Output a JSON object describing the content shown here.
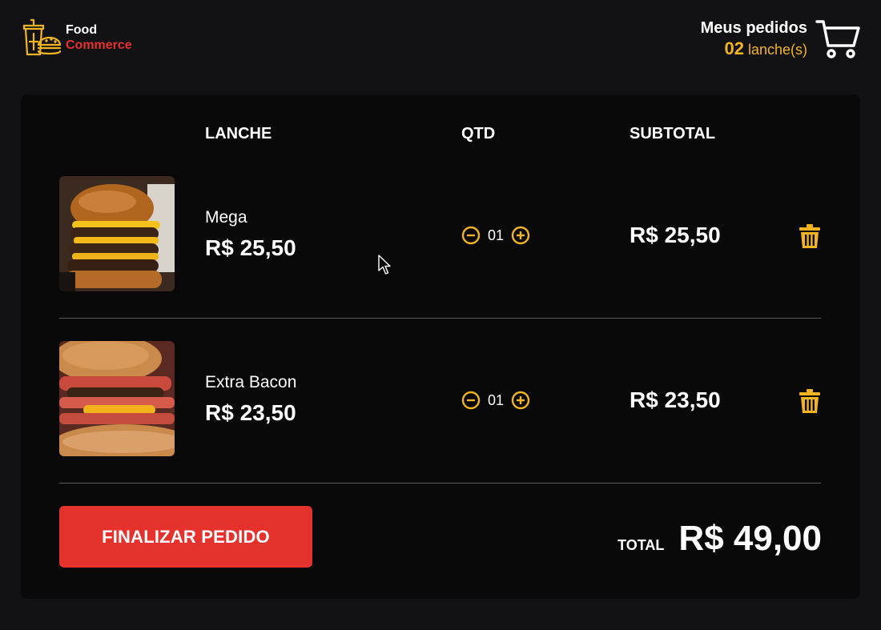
{
  "brand": {
    "line1": "Food",
    "line2": "Commerce",
    "logo_icon": "food-drink-burger-icon"
  },
  "orders": {
    "title": "Meus pedidos",
    "count": "02",
    "unit": "lanche(s)",
    "icon": "cart-icon"
  },
  "table": {
    "headers": {
      "item": "LANCHE",
      "qty": "QTD",
      "subtotal": "SUBTOTAL"
    },
    "rows": [
      {
        "name": "Mega",
        "price": "R$ 25,50",
        "qty": "01",
        "subtotal": "R$ 25,50",
        "image": "burger-photo"
      },
      {
        "name": "Extra Bacon",
        "price": "R$ 23,50",
        "qty": "01",
        "subtotal": "R$ 23,50",
        "image": "bacon-burger-photo"
      }
    ]
  },
  "footer": {
    "finalize_label": "FINALIZAR PEDIDO",
    "total_label": "TOTAL",
    "total_value": "R$ 49,00"
  },
  "colors": {
    "accent": "#f2b521",
    "brand_red": "#e5322d",
    "background": "#121214",
    "card": "#09090a"
  }
}
